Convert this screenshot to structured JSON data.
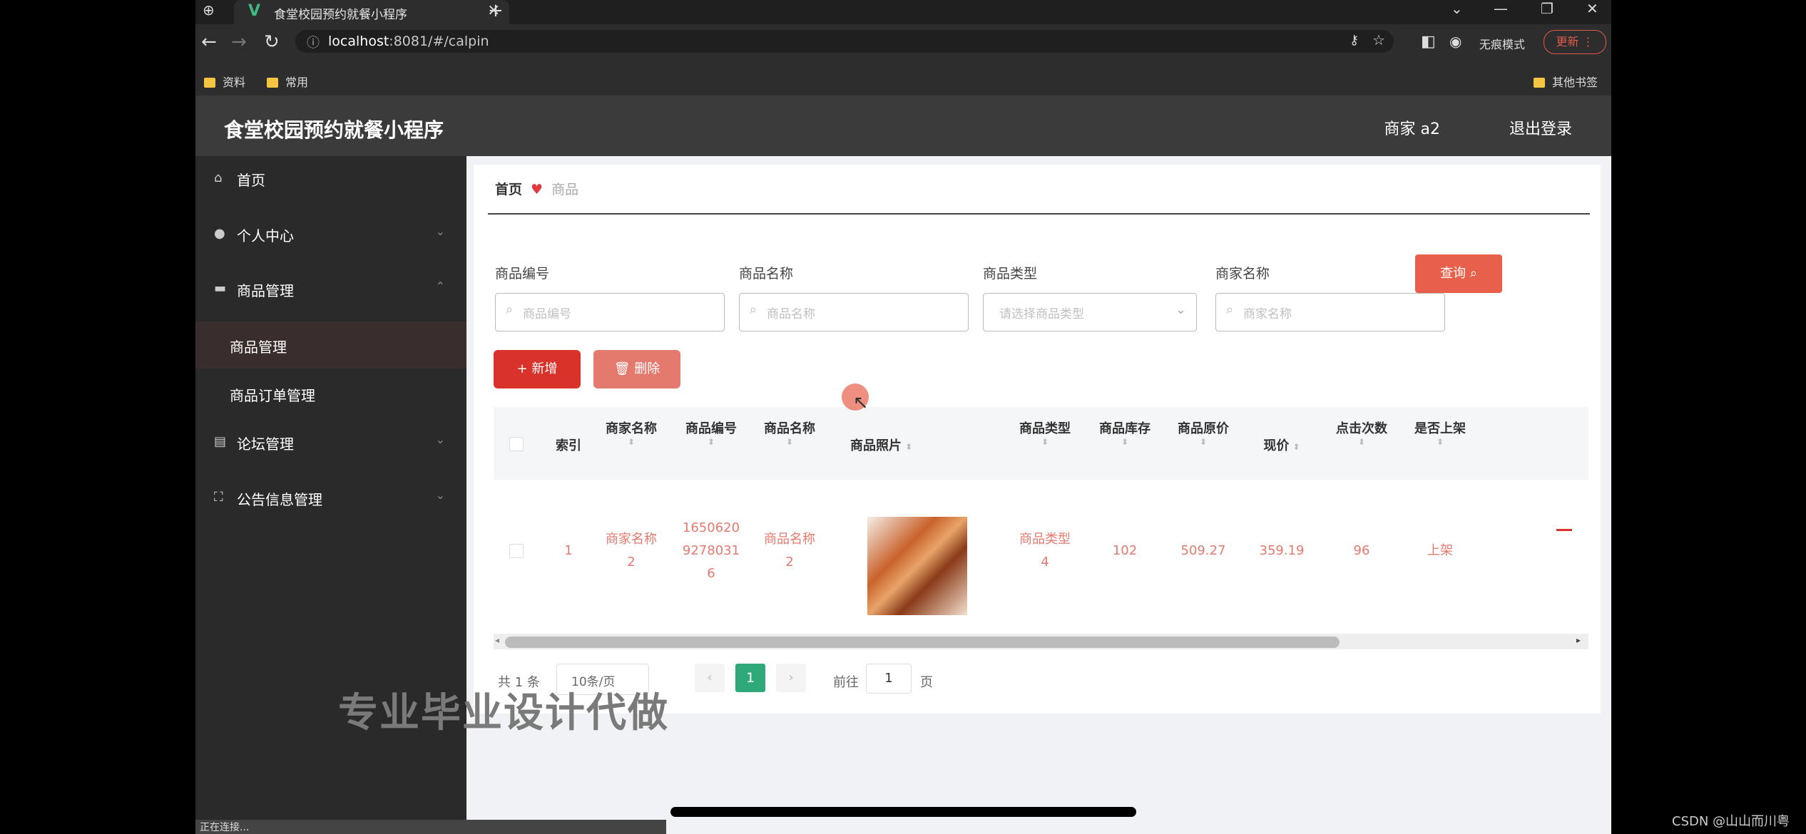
{
  "browser": {
    "tab_title": "食堂校园预约就餐小程序",
    "url_host": "localhost",
    "url_rest": ":8081/#/calpin",
    "incognito_label": "无痕模式",
    "update_label": "新",
    "update_prefix": "更",
    "bookmarks": [
      "资料",
      "常用"
    ],
    "other_bookmarks": "其他书签"
  },
  "app": {
    "title": "食堂校园预约就餐小程序",
    "user": "商家 a2",
    "logout": "退出登录"
  },
  "sidebar": {
    "items": [
      {
        "label": "首页",
        "icon": "home-icon"
      },
      {
        "label": "个人中心",
        "icon": "user-icon"
      },
      {
        "label": "商品管理",
        "icon": "goods-icon"
      },
      {
        "label": "商品管理",
        "icon": ""
      },
      {
        "label": "商品订单管理",
        "icon": ""
      },
      {
        "label": "论坛管理",
        "icon": "forum-icon"
      },
      {
        "label": "公告信息管理",
        "icon": "notice-icon"
      }
    ]
  },
  "breadcrumb": {
    "home": "首页",
    "current": "商品"
  },
  "filters": [
    {
      "label": "商品编号",
      "placeholder": "商品编号"
    },
    {
      "label": "商品名称",
      "placeholder": "商品名称"
    },
    {
      "label": "商品类型",
      "placeholder": "请选择商品类型"
    },
    {
      "label": "商家名称",
      "placeholder": "商家名称"
    }
  ],
  "buttons": {
    "search": "查询",
    "add": "新增",
    "delete": "删除"
  },
  "table": {
    "headers": [
      "索引",
      "商家名称",
      "商品编号",
      "商品名称",
      "商品照片",
      "商品类型",
      "商品库存",
      "商品原价",
      "现价",
      "点击次数",
      "是否上架"
    ],
    "row": {
      "index": "1",
      "merchant": [
        "商家名称",
        "2"
      ],
      "code": [
        "1650620",
        "9278031",
        "6"
      ],
      "name": [
        "商品名称",
        "2"
      ],
      "type": [
        "商品类型",
        "4"
      ],
      "stock": "102",
      "price": "509.27",
      "current": "359.19",
      "clicks": "96",
      "on_sale": "上架"
    }
  },
  "pagination": {
    "total": "共 1 条",
    "page_size": "10条/页",
    "current": "1",
    "goto": "前往",
    "goto_value": "1",
    "page_suffix": "页"
  },
  "overlay": {
    "watermark": "专业毕业设计代做",
    "status": "正在连接...",
    "csdn": "CSDN @山山而川粤"
  },
  "colors": {
    "accent": "#e8604c",
    "primary_red": "#d9322b",
    "page_active": "#2fa87a"
  }
}
